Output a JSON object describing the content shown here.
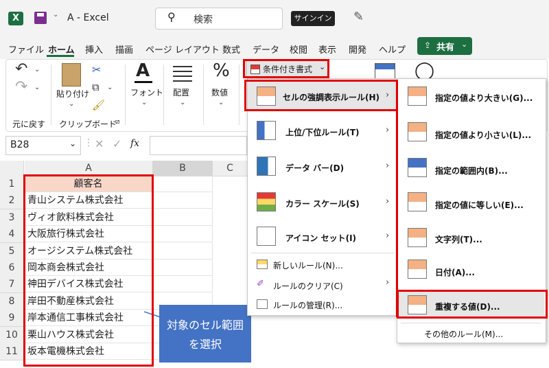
{
  "titlebar": {
    "app_icon": "X",
    "doc_title": "A  -  Excel",
    "search_placeholder": "検索",
    "signin_label": "サインイン"
  },
  "tabs": [
    "ファイル",
    "ホーム",
    "挿入",
    "描画",
    "ページ レイアウト",
    "数式",
    "データ",
    "校閲",
    "表示",
    "開発",
    "ヘルプ"
  ],
  "share_label": "共有",
  "ribbon": {
    "undo_group_label": "元に戻す",
    "paste_label": "貼り付け",
    "clipboard_label": "クリップボード",
    "font_label": "フォント",
    "align_label": "配置",
    "number_label": "数値",
    "cond_format_label": "条件付き書式"
  },
  "formula_bar": {
    "namebox_value": "B28",
    "fx_label": "fx"
  },
  "grid": {
    "columns": [
      "A",
      "B",
      "C"
    ],
    "rows": [
      "1",
      "2",
      "3",
      "4",
      "5",
      "6",
      "7",
      "8",
      "9",
      "10",
      "11"
    ],
    "cells": [
      "顧客名",
      "青山システム株式会社",
      "ヴィオ飲料株式会社",
      "大阪旅行株式会社",
      "オージシステム株式会社",
      "岡本商会株式会社",
      "神田デバイス株式会社",
      "岸田不動産株式会社",
      "岸本通信工事株式会社",
      "栗山ハウス株式会社",
      "坂本電機株式会社"
    ]
  },
  "menu1": {
    "items": [
      {
        "label": "セルの強調表示ルール(H)"
      },
      {
        "label": "上位/下位ルール(T)"
      },
      {
        "label": "データ バー(D)"
      },
      {
        "label": "カラー スケール(S)"
      },
      {
        "label": "アイコン セット(I)"
      },
      {
        "label": "新しいルール(N)..."
      },
      {
        "label": "ルールのクリア(C)"
      },
      {
        "label": "ルールの管理(R)..."
      }
    ]
  },
  "menu2": {
    "items": [
      {
        "label": "指定の値より大きい(G)..."
      },
      {
        "label": "指定の値より小さい(L)..."
      },
      {
        "label": "指定の範囲内(B)..."
      },
      {
        "label": "指定の値に等しい(E)..."
      },
      {
        "label": "文字列(T)..."
      },
      {
        "label": "日付(A)..."
      },
      {
        "label": "重複する値(D)..."
      },
      {
        "label": "その他のルール(M)..."
      }
    ]
  },
  "callout": {
    "line1": "対象のセル範囲",
    "line2": "を選択"
  },
  "colors": {
    "accent": "#1d6f42",
    "highlight": "#e00000",
    "callout_bg": "#4472c4",
    "header_fill": "#f8d7c8"
  }
}
